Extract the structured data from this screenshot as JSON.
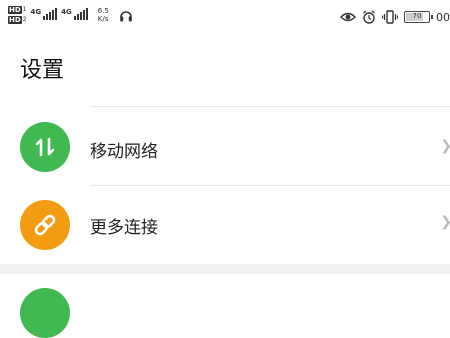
{
  "status_bar": {
    "sim1_badge": "HD",
    "sim2_badge": "HD",
    "sim1_network": "4G",
    "sim2_network": "4G",
    "speed_value": "6.5",
    "speed_unit": "K/s",
    "battery_level": "70",
    "clock_partial": "00"
  },
  "page": {
    "title": "设置"
  },
  "settings": {
    "items": [
      {
        "label": "移动网络",
        "icon": "data-transfer-icon",
        "color": "#3fb950"
      },
      {
        "label": "更多连接",
        "icon": "link-icon",
        "color": "#f39c12"
      }
    ],
    "next_item_color": "#3fb950"
  }
}
